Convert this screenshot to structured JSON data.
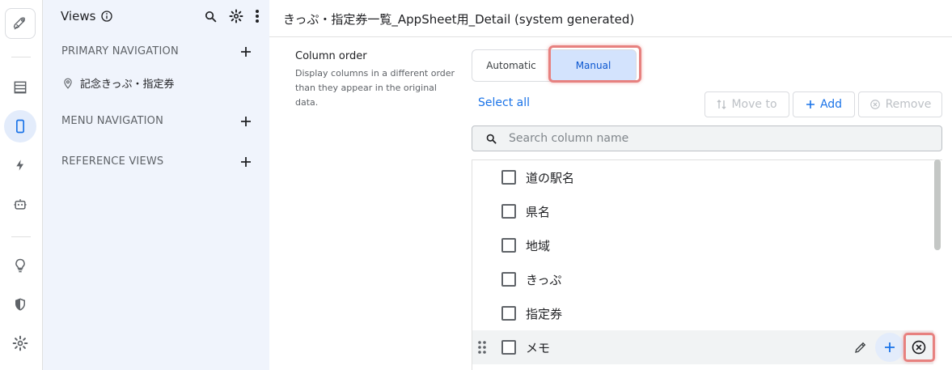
{
  "rail": {
    "items": [
      {
        "name": "rocket-icon"
      },
      {
        "name": "data-icon"
      },
      {
        "name": "app-icon"
      },
      {
        "name": "automation-icon"
      },
      {
        "name": "bot-icon"
      },
      {
        "name": "lightbulb-icon"
      },
      {
        "name": "security-icon"
      },
      {
        "name": "settings-icon"
      }
    ]
  },
  "views_panel": {
    "title": "Views",
    "sections": [
      {
        "label": "PRIMARY NAVIGATION"
      },
      {
        "label": "MENU NAVIGATION"
      },
      {
        "label": "REFERENCE VIEWS"
      }
    ],
    "primary_items": [
      {
        "label": "記念きっぷ・指定券"
      }
    ]
  },
  "header": {
    "title": "きっぷ・指定券一覧_AppSheet用_Detail (system generated)"
  },
  "setting": {
    "label": "Column order",
    "description": "Display columns in a different order than they appear in the original data."
  },
  "toggle": {
    "automatic": "Automatic",
    "manual": "Manual",
    "selected": "Manual"
  },
  "actions": {
    "select_all": "Select all",
    "move_to": "Move to",
    "add": "Add",
    "remove": "Remove"
  },
  "search": {
    "placeholder": "Search column name",
    "value": ""
  },
  "columns": [
    {
      "label": "道の駅名"
    },
    {
      "label": "県名"
    },
    {
      "label": "地域"
    },
    {
      "label": "きっぷ"
    },
    {
      "label": "指定券"
    },
    {
      "label": "メモ"
    }
  ],
  "colors": {
    "accent": "#1a73e8",
    "highlight": "#e7817f",
    "panel_bg": "#f0f4fc"
  }
}
